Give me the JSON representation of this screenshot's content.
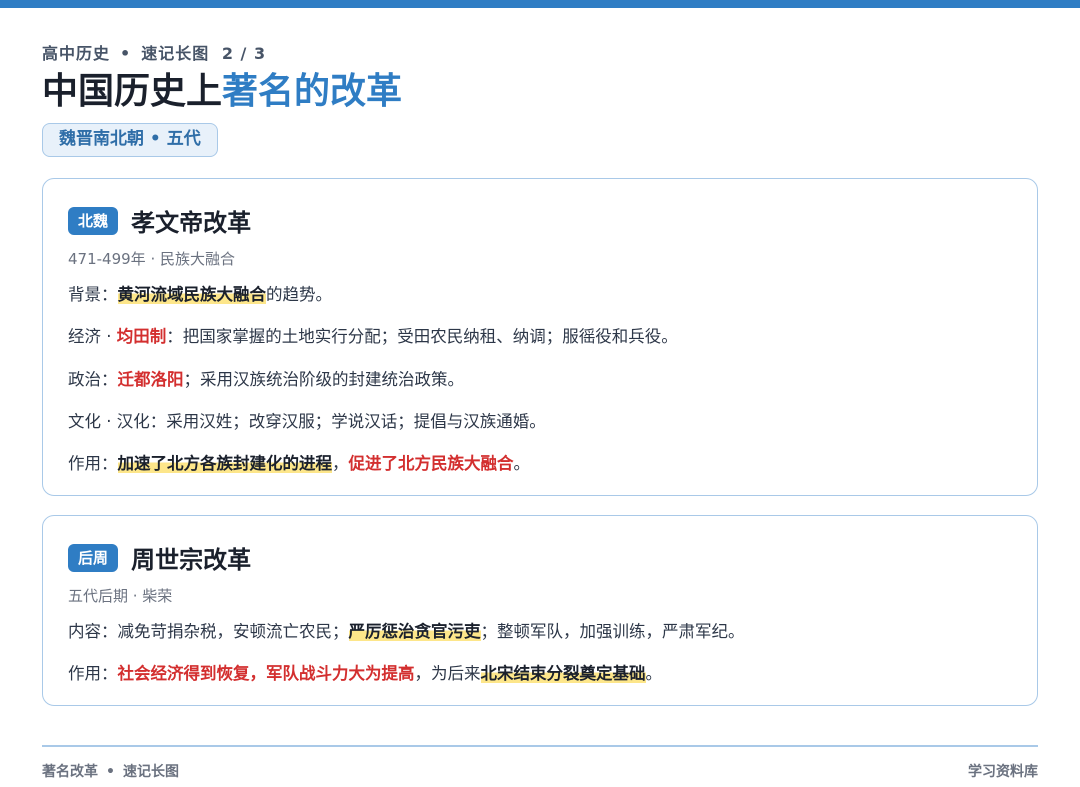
{
  "header": {
    "subject": "高中历史",
    "sep": "•",
    "series": "速记长图",
    "page": "2 / 3",
    "title_main": "中国历史上",
    "title_accent": "著名的改革",
    "period": "魏晋南北朝 • 五代"
  },
  "cards": [
    {
      "tag": "北魏",
      "title": "孝文帝改革",
      "meta": "471-499年 · 民族大融合",
      "lines": [
        {
          "label": "背景：",
          "hl": "黄河流域民族大融合",
          "rest": "的趋势。"
        },
        {
          "label": "经济 · ",
          "red": "均田制",
          "rest": "：把国家掌握的土地实行分配；受田农民纳租、纳调；服徭役和兵役。"
        },
        {
          "label": "政治：",
          "red": "迁都洛阳",
          "rest": "；采用汉族统治阶级的封建统治政策。"
        },
        {
          "label": "文化 · 汉化：采用汉姓；改穿汉服；学说汉话；提倡与汉族通婚。"
        },
        {
          "label": "作用：",
          "hl": "加速了北方各族封建化的进程",
          "sep": "，",
          "red": "促进了北方民族大融合",
          "end": "。"
        }
      ]
    },
    {
      "tag": "后周",
      "title": "周世宗改革",
      "meta": "五代后期 · 柴荣",
      "lines": [
        {
          "label": "内容：减免苛捐杂税，安顿流亡农民；",
          "hl": "严厉惩治贪官污吏",
          "rest": "；整顿军队，加强训练，严肃军纪。"
        },
        {
          "label": "作用：",
          "red": "社会经济得到恢复，军队战斗力大为提高",
          "mid": "，为后来",
          "hl": "北宋结束分裂奠定基础",
          "end": "。"
        }
      ]
    }
  ],
  "footer": {
    "left_a": "著名改革",
    "sep": "•",
    "left_b": "速记长图",
    "right": "学习资料库"
  },
  "colors": {
    "accent": "#2f7dc4",
    "highlight": "#fde68a",
    "emphasis_red": "#d32f2f"
  }
}
